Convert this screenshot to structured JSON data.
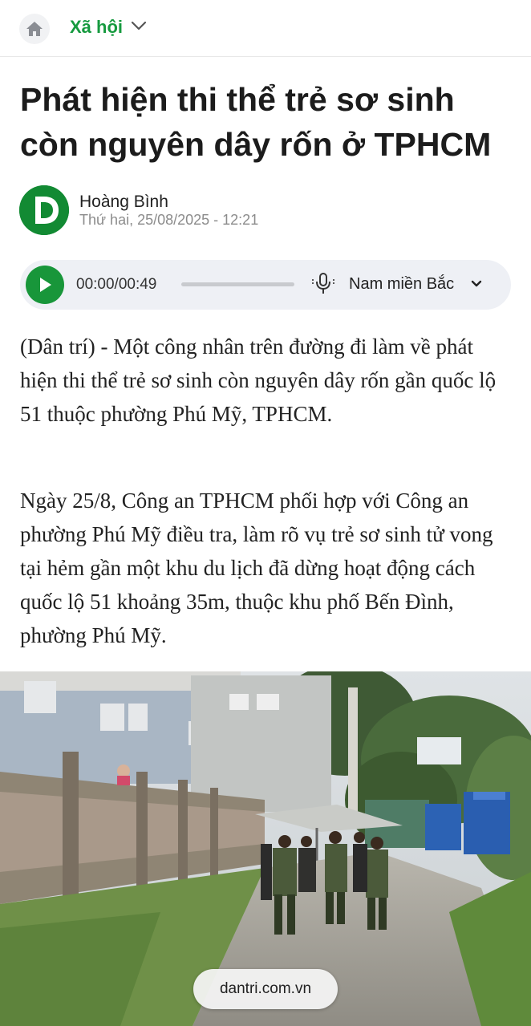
{
  "header": {
    "section_label": "Xã hội",
    "home_icon": "home-icon",
    "chevron_icon": "chevron-down-icon"
  },
  "article": {
    "title": "Phát hiện thi thể trẻ sơ sinh còn nguyên dây rốn ở TPHCM",
    "author": "Hoàng Bình",
    "date": "Thứ hai, 25/08/2025 - 12:21",
    "avatar_letter": "D",
    "paragraphs": [
      "(Dân trí) - Một công nhân trên đường đi làm về phát hiện thi thể trẻ sơ sinh còn nguyên dây rốn gần quốc lộ 51 thuộc phường Phú Mỹ, TPHCM.",
      "Ngày 25/8, Công an TPHCM phối hợp với Công an phường Phú Mỹ điều tra, làm rõ vụ trẻ sơ sinh tử vong tại hẻm gần một khu du lịch đã dừng hoạt động cách quốc lộ 51 khoảng 35m, thuộc khu phố Bến Đình, phường Phú Mỹ."
    ]
  },
  "audio_player": {
    "time": "00:00/00:49",
    "progress": 0,
    "voice": "Nam miền Bắc",
    "play_icon": "play-icon",
    "mic_icon": "microphone-icon"
  },
  "browser": {
    "url": "dantri.com.vn"
  },
  "colors": {
    "brand_green": "#169a3f",
    "player_bg": "#eef0f5"
  }
}
